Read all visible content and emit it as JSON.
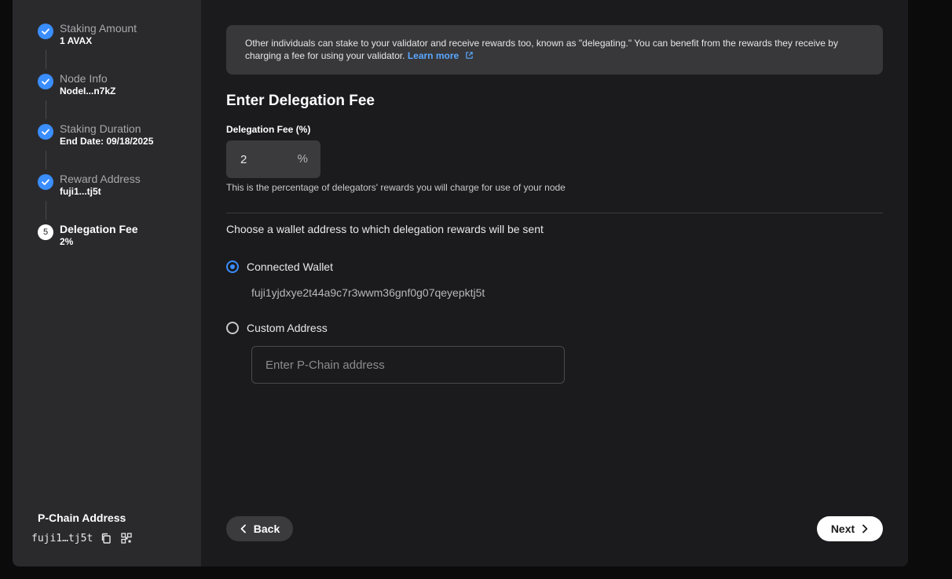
{
  "sidebar": {
    "steps": [
      {
        "title": "Staking Amount",
        "value": "1 AVAX",
        "status": "complete"
      },
      {
        "title": "Node Info",
        "value": "NodeI...n7kZ",
        "status": "complete"
      },
      {
        "title": "Staking Duration",
        "value": "End Date: 09/18/2025",
        "status": "complete"
      },
      {
        "title": "Reward Address",
        "value": "fuji1...tj5t",
        "status": "complete"
      },
      {
        "title": "Delegation Fee",
        "value": "2%",
        "status": "current",
        "number": "5"
      }
    ],
    "pchain_label": "P-Chain Address",
    "pchain_address": "fuji1…tj5t"
  },
  "info": {
    "text": "Other individuals can stake to your validator and receive rewards too, known as \"delegating.\" You can benefit from the rewards they receive by charging a fee for using your validator.",
    "link": "Learn more"
  },
  "main": {
    "title": "Enter Delegation Fee",
    "fee_label": "Delegation Fee (%)",
    "fee_value": "2",
    "fee_unit": "%",
    "fee_help": "This is the percentage of delegators' rewards you will charge for use of your node",
    "choose_text": "Choose a wallet address to which delegation rewards will be sent",
    "option_connected": "Connected Wallet",
    "connected_address": "fuji1yjdxye2t44a9c7r3wwm36gnf0g07qeyepktj5t",
    "option_custom": "Custom Address",
    "custom_placeholder": "Enter P-Chain address",
    "selected_option": "connected"
  },
  "buttons": {
    "back": "Back",
    "next": "Next"
  },
  "colors": {
    "accent": "#3a8eff",
    "link": "#5aa7ff"
  }
}
